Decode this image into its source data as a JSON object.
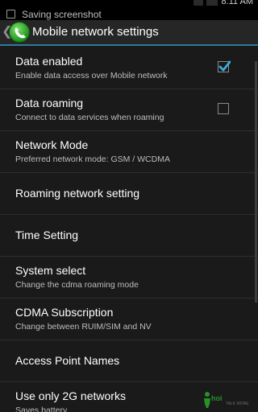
{
  "status_bar": {
    "notification_text": "Saving screenshot",
    "clock": "8:11 AM"
  },
  "action_bar": {
    "title": "Mobile network settings"
  },
  "settings": {
    "items": [
      {
        "label": "Data enabled",
        "summary": "Enable data access over Mobile network",
        "checked": true
      },
      {
        "label": "Data roaming",
        "summary": "Connect to data services when roaming",
        "checked": false
      },
      {
        "label": "Network Mode",
        "summary": "Preferred network mode: GSM / WCDMA"
      },
      {
        "label": "Roaming network setting"
      },
      {
        "label": "Time Setting"
      },
      {
        "label": "System select",
        "summary": "Change the cdma roaming mode"
      },
      {
        "label": "CDMA Subscription",
        "summary": "Change between RUIM/SIM and NV"
      },
      {
        "label": "Access Point Names"
      },
      {
        "label": "Use only 2G networks",
        "summary": "Saves battery"
      }
    ]
  },
  "watermark": {
    "brand": "hoi",
    "tagline": "TALK MORE"
  },
  "colors": {
    "accent": "#2d7a9a",
    "check": "#33b5e5",
    "app_icon": "#2e9e2e"
  }
}
